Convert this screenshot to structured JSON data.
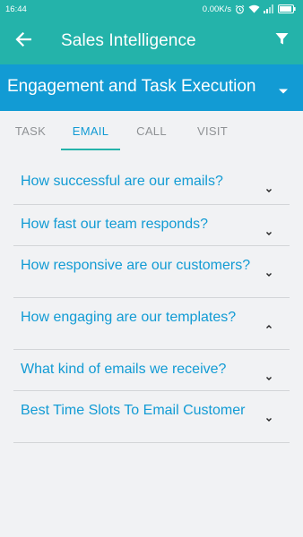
{
  "status_bar": {
    "time": "16:44",
    "net_speed": "0.00K/s"
  },
  "app_bar": {
    "title": "Sales Intelligence",
    "back_icon": "arrow-back-icon",
    "filter_icon": "filter-icon"
  },
  "section": {
    "title": "Engagement and Task Execution"
  },
  "tabs": [
    {
      "label": "TASK",
      "active": false
    },
    {
      "label": "EMAIL",
      "active": true
    },
    {
      "label": "CALL",
      "active": false
    },
    {
      "label": "VISIT",
      "active": false
    }
  ],
  "questions": [
    {
      "text": "How successful are our emails?",
      "expanded": false
    },
    {
      "text": "How fast our team responds?",
      "expanded": false
    },
    {
      "text": "How responsive are our customers?",
      "expanded": false
    },
    {
      "text": "How engaging are our templates?",
      "expanded": true
    },
    {
      "text": "What kind of emails we receive?",
      "expanded": false
    },
    {
      "text": "Best Time Slots To Email Customer",
      "expanded": false
    }
  ],
  "colors": {
    "teal": "#24b3aa",
    "blue": "#129bd4",
    "background": "#f1f2f4",
    "tab_inactive": "#8f9295",
    "divider": "#d3d5d8"
  }
}
